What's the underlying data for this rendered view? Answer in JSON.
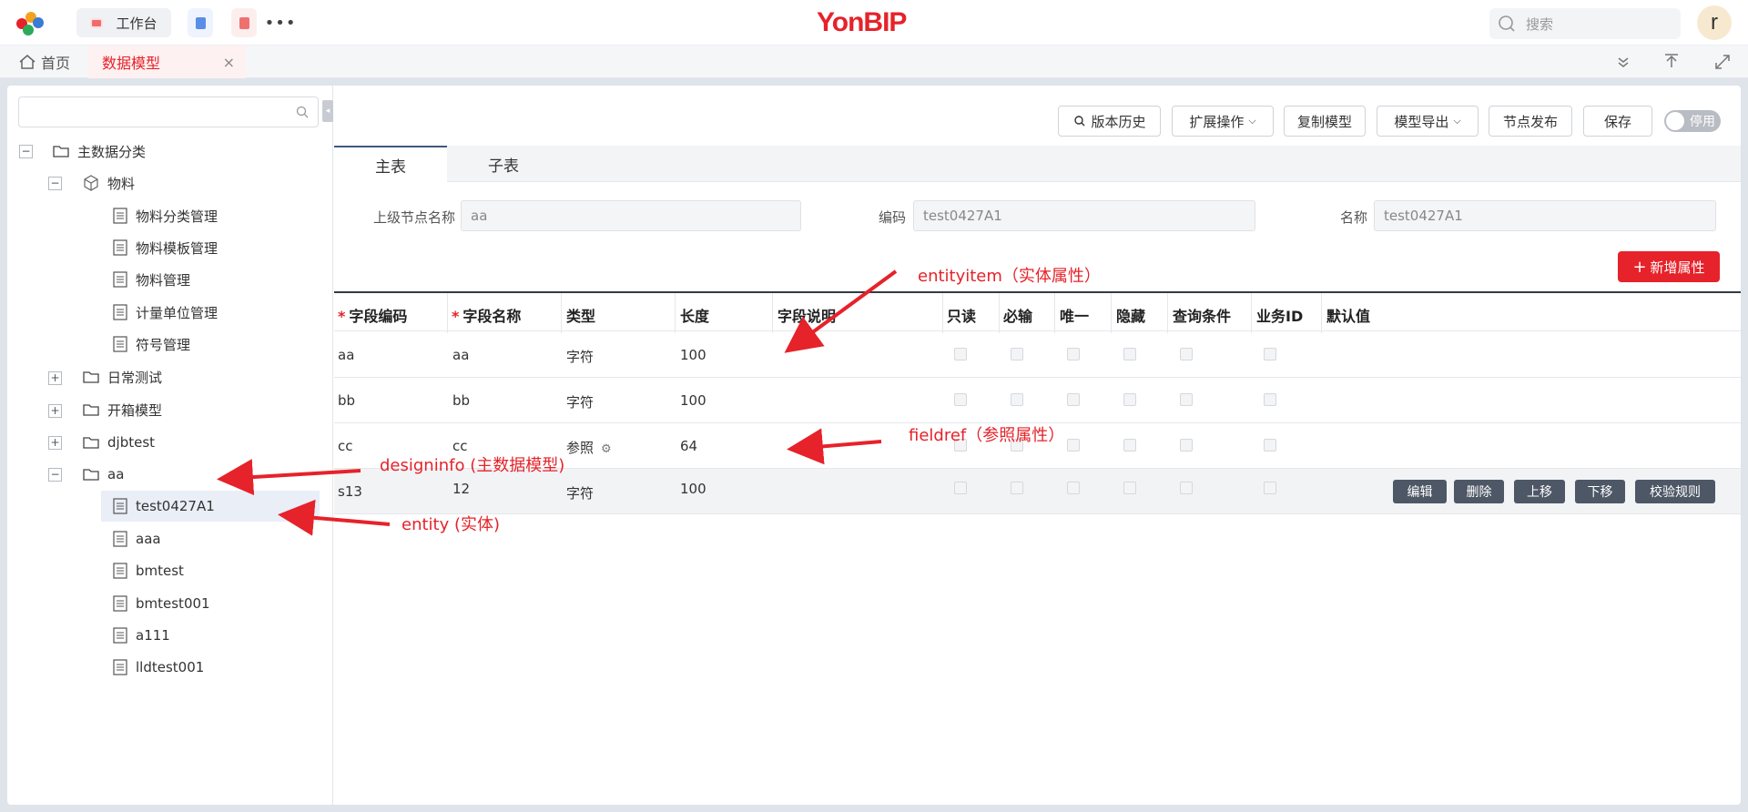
{
  "topbar": {
    "workbench_label": "工作台",
    "brand": "YonBIP",
    "search_placeholder": "搜索",
    "avatar_letter": "r"
  },
  "tabs": {
    "home": "首页",
    "current": "数据模型",
    "close": "×"
  },
  "toolbar": {
    "history": "版本历史",
    "extend": "扩展操作",
    "copy": "复制模型",
    "export": "模型导出",
    "publish": "节点发布",
    "save": "保存",
    "stop": "停用"
  },
  "content_tabs": [
    "主表",
    "子表"
  ],
  "form": {
    "parent_label": "上级节点名称",
    "parent_value": "aa",
    "code_label": "编码",
    "code_value": "test0427A1",
    "name_label": "名称",
    "name_value": "test0427A1"
  },
  "add_button": "新增属性",
  "table": {
    "headers": [
      "字段编码",
      "字段名称",
      "类型",
      "长度",
      "字段说明",
      "只读",
      "必输",
      "唯一",
      "隐藏",
      "查询条件",
      "业务ID",
      "默认值"
    ],
    "rows": [
      {
        "code": "aa",
        "name": "aa",
        "type": "字符",
        "length": "100"
      },
      {
        "code": "bb",
        "name": "bb",
        "type": "字符",
        "length": "100"
      },
      {
        "code": "cc",
        "name": "cc",
        "type": "参照",
        "length": "64"
      },
      {
        "code": "s13",
        "name": "12",
        "type": "字符",
        "length": "100"
      }
    ],
    "row_actions": [
      "编辑",
      "删除",
      "上移",
      "下移",
      "校验规则"
    ]
  },
  "tree": {
    "root": "主数据分类",
    "material": "物料",
    "material_children": [
      "物料分类管理",
      "物料模板管理",
      "物料管理",
      "计量单位管理",
      "符号管理"
    ],
    "daily": "日常测试",
    "unbox": "开箱模型",
    "djb": "djbtest",
    "aa": "aa",
    "aa_children": [
      "test0427A1",
      "aaa",
      "bmtest",
      "bmtest001",
      "a111",
      "lldtest001"
    ]
  },
  "annotations": {
    "entityitem": "entityitem（实体属性）",
    "fieldref": "fieldref（参照属性）",
    "designinfo": "designinfo (主数据模型)",
    "entity": "entity (实体)"
  },
  "colors": {
    "accent": "#e6222a",
    "dark": "#4e5766"
  },
  "icons": [
    "search-icon",
    "home-icon",
    "folder-icon",
    "cube-icon",
    "document-icon",
    "chevron-down-icon",
    "upload-icon",
    "expand-icon",
    "gear-icon",
    "plus-icon"
  ]
}
